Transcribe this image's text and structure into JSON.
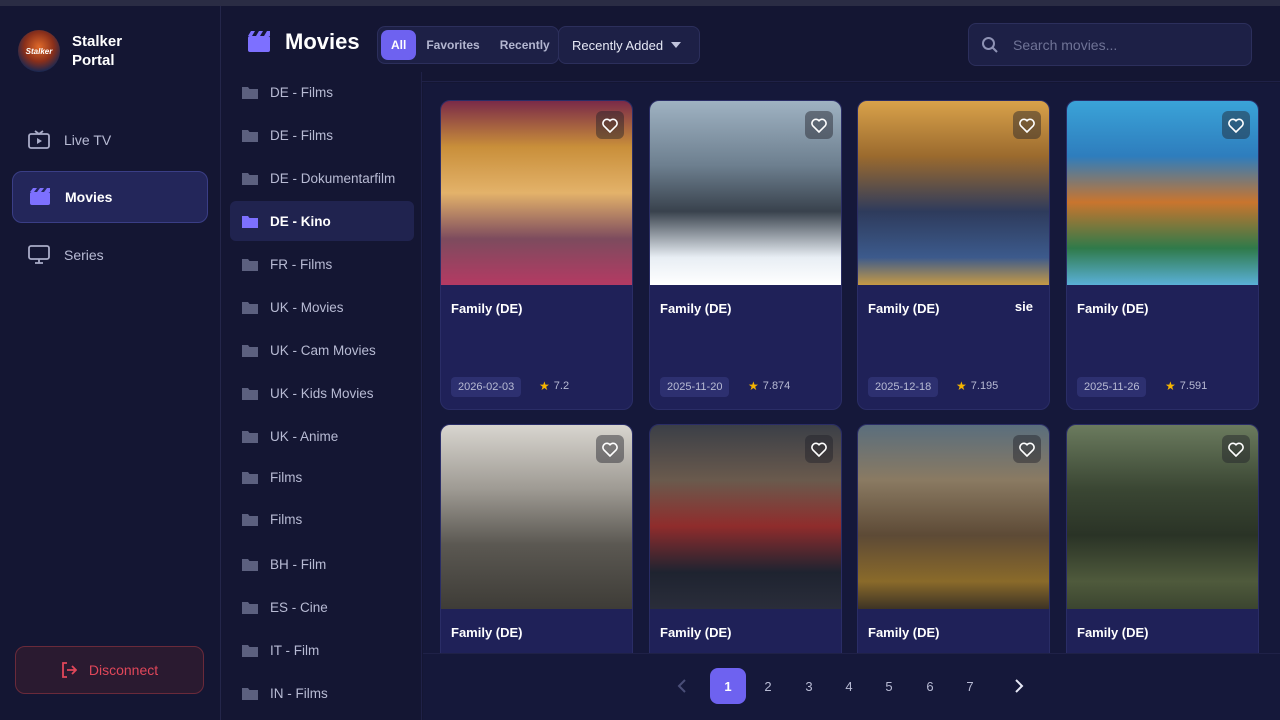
{
  "app": {
    "name_line1": "Stalker",
    "name_line2": "Portal",
    "logo_text": "Stalker"
  },
  "sidebar": {
    "items": [
      {
        "label": "Live TV",
        "icon": "tv-icon"
      },
      {
        "label": "Movies",
        "icon": "clapperboard-icon",
        "active": true
      },
      {
        "label": "Series",
        "icon": "monitor-icon"
      }
    ],
    "disconnect_label": "Disconnect"
  },
  "header": {
    "title": "Movies",
    "filters": [
      "All",
      "Favorites",
      "Recently"
    ],
    "active_filter": "All",
    "sort_label": "Recently Added",
    "search_placeholder": "Search movies..."
  },
  "categories": [
    "DE - Films",
    "DE - Films",
    "DE - Dokumentarfilm",
    "DE - Kino",
    "FR - Films",
    "UK - Movies",
    "UK - Cam Movies",
    "UK - Kids Movies",
    "UK - Anime",
    "Films",
    "Films",
    "BH - Film",
    "ES - Cine",
    "IT - Film",
    "IN - Films"
  ],
  "active_category": "DE - Kino",
  "movies": [
    {
      "title": "Family (DE)",
      "date": "2026-02-03",
      "rating": "7.2",
      "extra": ""
    },
    {
      "title": "Family (DE)",
      "date": "2025-11-20",
      "rating": "7.874",
      "extra": ""
    },
    {
      "title": "Family (DE)",
      "date": "2025-12-18",
      "rating": "7.195",
      "extra": "sie"
    },
    {
      "title": "Family (DE)",
      "date": "2025-11-26",
      "rating": "7.591",
      "extra": ""
    },
    {
      "title": "Family (DE)",
      "date": "",
      "rating": "",
      "extra": ""
    },
    {
      "title": "Family (DE)",
      "date": "",
      "rating": "",
      "extra": ""
    },
    {
      "title": "Family (DE)",
      "date": "",
      "rating": "",
      "extra": ""
    },
    {
      "title": "Family (DE)",
      "date": "",
      "rating": "",
      "extra": ""
    }
  ],
  "pagination": {
    "pages": [
      "1",
      "2",
      "3",
      "4",
      "5",
      "6",
      "7"
    ],
    "current": "1"
  },
  "colors": {
    "accent": "#6e62f0",
    "background": "#141633",
    "card": "#1f2158",
    "danger": "#e0475a",
    "star": "#f5b400"
  }
}
